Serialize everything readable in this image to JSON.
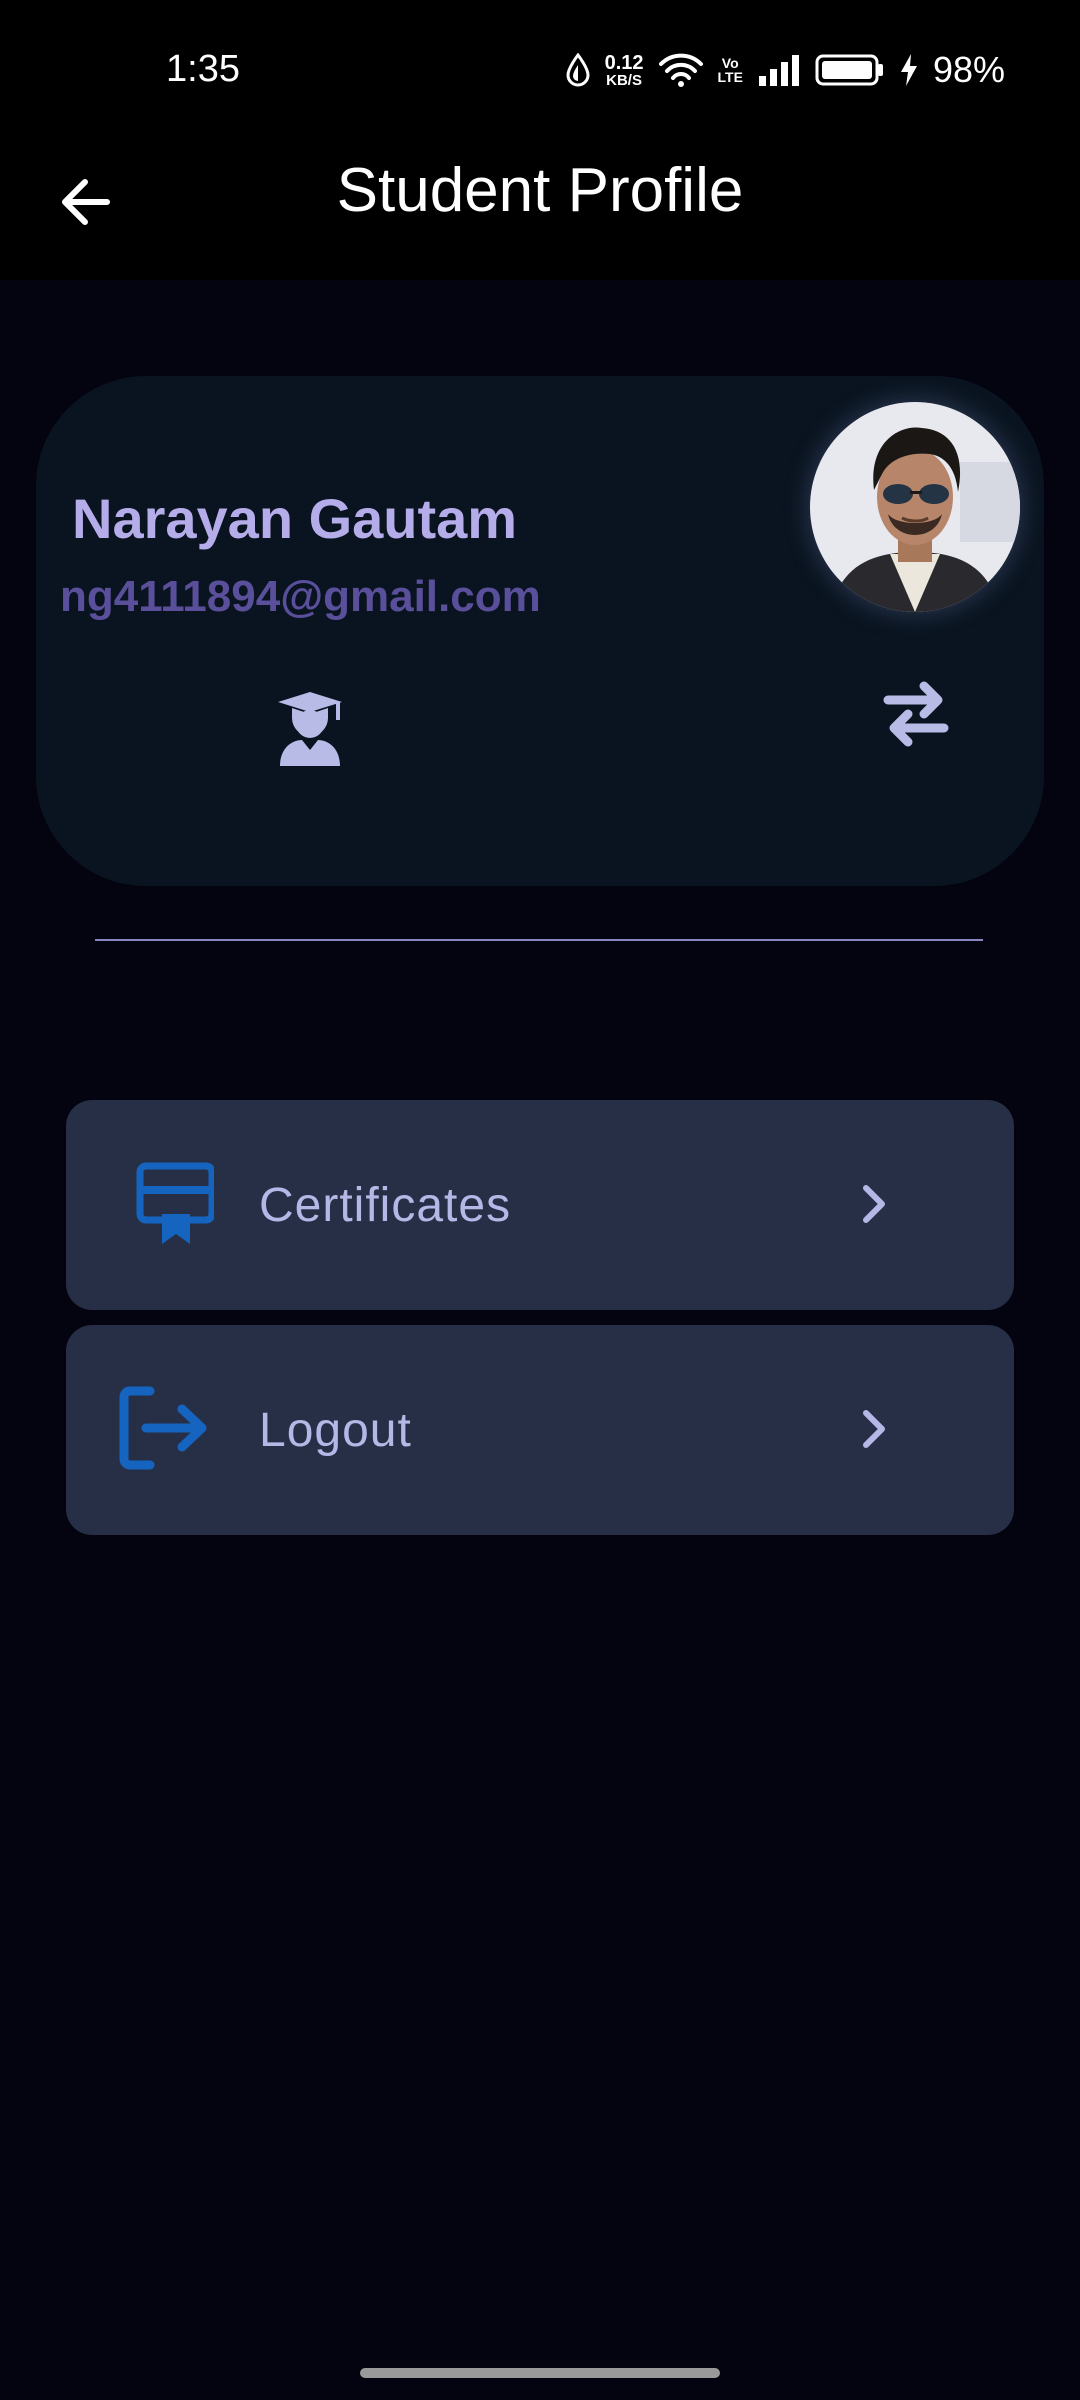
{
  "status_bar": {
    "time": "1:35",
    "net_speed_value": "0.12",
    "net_speed_unit": "KB/S",
    "volte_top": "Vo",
    "volte_bottom": "LTE",
    "battery_percent": "98%"
  },
  "app_bar": {
    "title": "Student Profile",
    "back_icon": "arrow-left-icon"
  },
  "profile": {
    "name": "Narayan Gautam",
    "email": "ng4111894@gmail.com",
    "role_icon": "graduate-student-icon",
    "swap_icon": "swap-arrows-icon"
  },
  "menu": {
    "items": [
      {
        "label": "Certificates",
        "icon": "certificate-icon"
      },
      {
        "label": "Logout",
        "icon": "logout-icon"
      }
    ]
  },
  "colors": {
    "background": "#03040f",
    "card": "#0a1420",
    "menu_item": "#272f46",
    "name": "#b5acea",
    "email": "#5a4f9a",
    "icon_accent": "#1565c0"
  }
}
